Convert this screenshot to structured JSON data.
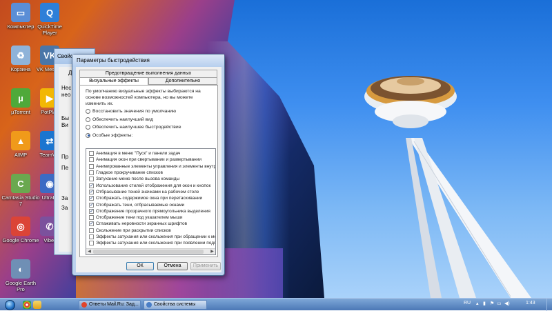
{
  "desktop_icons": [
    {
      "name": "computer-icon",
      "label": "Компьютер",
      "color": "#5b8ed6",
      "glyph": "▭"
    },
    {
      "name": "quicktime-icon",
      "label": "QuickTime Player",
      "color": "#2e7fd8",
      "glyph": "Q"
    },
    {
      "name": "recycle-bin-icon",
      "label": "Корзина",
      "color": "#8fb3d9",
      "glyph": "♻"
    },
    {
      "name": "vk-messenger-icon",
      "label": "VK Messen",
      "color": "#4a76a8",
      "glyph": "VK"
    },
    {
      "name": "utorrent-icon",
      "label": "µTorrent",
      "color": "#4fa93a",
      "glyph": "µ"
    },
    {
      "name": "potplayer-icon",
      "label": "PotPlay",
      "color": "#f2b705",
      "glyph": "▶"
    },
    {
      "name": "aimp-icon",
      "label": "AIMP",
      "color": "#f09a1a",
      "glyph": "▲"
    },
    {
      "name": "teamviewer-icon",
      "label": "TeamVie",
      "color": "#1b75d0",
      "glyph": "⇄"
    },
    {
      "name": "camtasia-icon",
      "label": "Camtasia Studio 7",
      "color": "#6aa84f",
      "glyph": "C"
    },
    {
      "name": "ultraiso-icon",
      "label": "UltraIS",
      "color": "#3c6bc4",
      "glyph": "◉"
    },
    {
      "name": "google-chrome-icon",
      "label": "Google Chrome",
      "color": "#db4437",
      "glyph": "◎"
    },
    {
      "name": "viber-icon",
      "label": "Viber",
      "color": "#7b519d",
      "glyph": "✆"
    },
    {
      "name": "google-earth-icon",
      "label": "Google Earth Pro",
      "color": "#6f8fb5",
      "glyph": "◐"
    }
  ],
  "behind_window": {
    "title": "Свойс",
    "tab": "До",
    "labels": [
      "Нес",
      "нео",
      "Бы",
      "Ви",
      "Пр",
      "Пе",
      "За",
      "За"
    ]
  },
  "dialog": {
    "title": "Параметры быстродействия",
    "tab_top": "Предотвращение выполнения данных",
    "tabs": [
      "Визуальные эффекты",
      "Дополнительно"
    ],
    "description": "По умолчанию визуальные эффекты выбираются на основе возможностей компьютера, но вы можете изменить их.",
    "radios": [
      {
        "label": "Восстановить значения по умолчанию",
        "selected": false
      },
      {
        "label": "Обеспечить наилучший вид",
        "selected": false
      },
      {
        "label": "Обеспечить наилучшее быстродействие",
        "selected": false
      },
      {
        "label": "Особые эффекты:",
        "selected": true
      }
    ],
    "effects": [
      {
        "label": "Анимация в меню \"Пуск\" и панели задач",
        "checked": false
      },
      {
        "label": "Анимация окон при свертывании и развертывании",
        "checked": false
      },
      {
        "label": "Анимированные элементы управления и элементы внутри",
        "checked": false
      },
      {
        "label": "Гладкое прокручивание списков",
        "checked": false
      },
      {
        "label": "Затухание меню после вызова команды",
        "checked": false
      },
      {
        "label": "Использование стилей отображения для окон и кнопок",
        "checked": true
      },
      {
        "label": "Отбрасывание теней значками на рабочем столе",
        "checked": true
      },
      {
        "label": "Отображать содержимое окна при перетаскивании",
        "checked": true
      },
      {
        "label": "Отображать тени, отбрасываемые окнами",
        "checked": true
      },
      {
        "label": "Отображение прозрачного прямоугольника выделения",
        "checked": true
      },
      {
        "label": "Отображение тени под указателем мыши",
        "checked": false
      },
      {
        "label": "Сглаживать неровности экранных шрифтов",
        "checked": true
      },
      {
        "label": "Скольжение при раскрытии списков",
        "checked": false
      },
      {
        "label": "Эффекты затухания или скольжения при обращении к ме",
        "checked": false
      },
      {
        "label": "Эффекты затухания или скольжения при появлении подс",
        "checked": false
      }
    ],
    "buttons": {
      "ok": "ОК",
      "cancel": "Отмена",
      "apply": "Применить"
    }
  },
  "taskbar": {
    "tasks": [
      {
        "label": "Ответы Mail.Ru: Зад...",
        "icon_color": "#e0452c",
        "active": false
      },
      {
        "label": "Свойства системы",
        "icon_color": "#4a7ec6",
        "active": true
      }
    ],
    "lang": "RU",
    "time": "1:43"
  }
}
